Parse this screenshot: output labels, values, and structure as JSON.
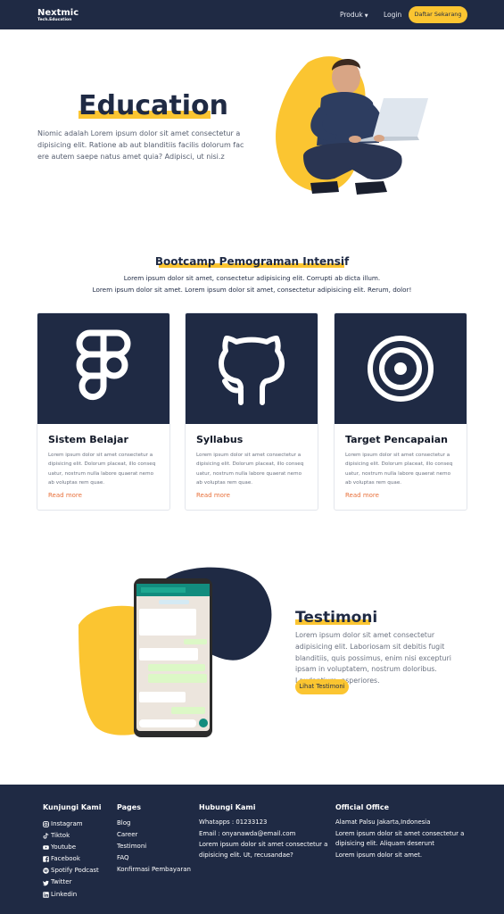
{
  "nav": {
    "brand": "Nextmic",
    "brand_sub": "Tech.Education",
    "produk": "Produk",
    "login": "Login",
    "cta": "Daftar Sekarang"
  },
  "hero": {
    "title": "Education",
    "text": "Niomic adalah Lorem ipsum dolor sit amet consectetur a dipisicing elit. Ratione ab aut blanditiis facilis dolorum fac ere autem saepe natus amet quia? Adipisci, ut nisi.z"
  },
  "bootcamp": {
    "title": "Bootcamp Pemograman Intensif",
    "line1": "Lorem ipsum dolor sit amet, consectetur adipisicing elit. Corrupti ab dicta illum.",
    "line2": "Lorem ipsum dolor sit amet. Lorem ipsum dolor sit amet, consectetur adipisicing elit. Rerum, dolor!",
    "cards": [
      {
        "title": "Sistem Belajar",
        "icon": "figma-icon",
        "text": "Lorem ipsum dolor sit amet consectetur a dipisicing elit. Dolorum placeat, illo conseq uatur, nostrum nulla labore quaerat nemo ab voluptas rem quae.",
        "link": "Read more"
      },
      {
        "title": "Syllabus",
        "icon": "github-icon",
        "text": "Lorem ipsum dolor sit amet consectetur a dipisicing elit. Dolorum placeat, illo conseq uatur, nostrum nulla labore quaerat nemo ab voluptas rem quae.",
        "link": "Read more"
      },
      {
        "title": "Target Pencapaian",
        "icon": "target-icon",
        "text": "Lorem ipsum dolor sit amet consectetur a dipisicing elit. Dolorum placeat, illo conseq uatur, nostrum nulla labore quaerat nemo ab voluptas rem quae.",
        "link": "Read more"
      }
    ]
  },
  "testimoni": {
    "title": "Testimoni",
    "text": "Lorem ipsum dolor sit amet consectetur adipisicing elit. Laboriosam sit debitis fugit blanditiis, quis possimus, enim nisi excepturi ipsam in voluptatem, nostrum doloribus. Laudantium, asperiores.",
    "button": "Lihat Testimoni"
  },
  "footer": {
    "kunjungi": {
      "title": "Kunjungi Kami",
      "items": [
        {
          "label": "Instagram",
          "icon": "instagram-icon"
        },
        {
          "label": "Tiktok",
          "icon": "tiktok-icon"
        },
        {
          "label": "Youtube",
          "icon": "youtube-icon"
        },
        {
          "label": "Facebook",
          "icon": "facebook-icon"
        },
        {
          "label": "Spotify Podcast",
          "icon": "spotify-icon"
        },
        {
          "label": "Twitter",
          "icon": "twitter-icon"
        },
        {
          "label": "Linkedin",
          "icon": "linkedin-icon"
        }
      ]
    },
    "pages": {
      "title": "Pages",
      "items": [
        "Blog",
        "Career",
        "Testimoni",
        "FAQ",
        "Konfirmasi Pembayaran"
      ]
    },
    "hubungi": {
      "title": "Hubungi Kami",
      "whatsapp": "Whatapps : 01233123",
      "email": "Email : onyanawda@email.com",
      "desc": "Lorem ipsum dolor sit amet consectetur a dipisicing elit. Ut, recusandae?"
    },
    "office": {
      "title": "Official Office",
      "address": "Alamat Palsu Jakarta,Indonesia",
      "desc1": "Lorem ipsum dolor sit amet consectetur a dipisicing elit. Aliquam deserunt",
      "desc2": "Lorem ipsum dolor sit amet."
    }
  },
  "colors": {
    "navy": "#1f2a44",
    "yellow": "#fbc531",
    "link_orange": "#e8703a"
  }
}
